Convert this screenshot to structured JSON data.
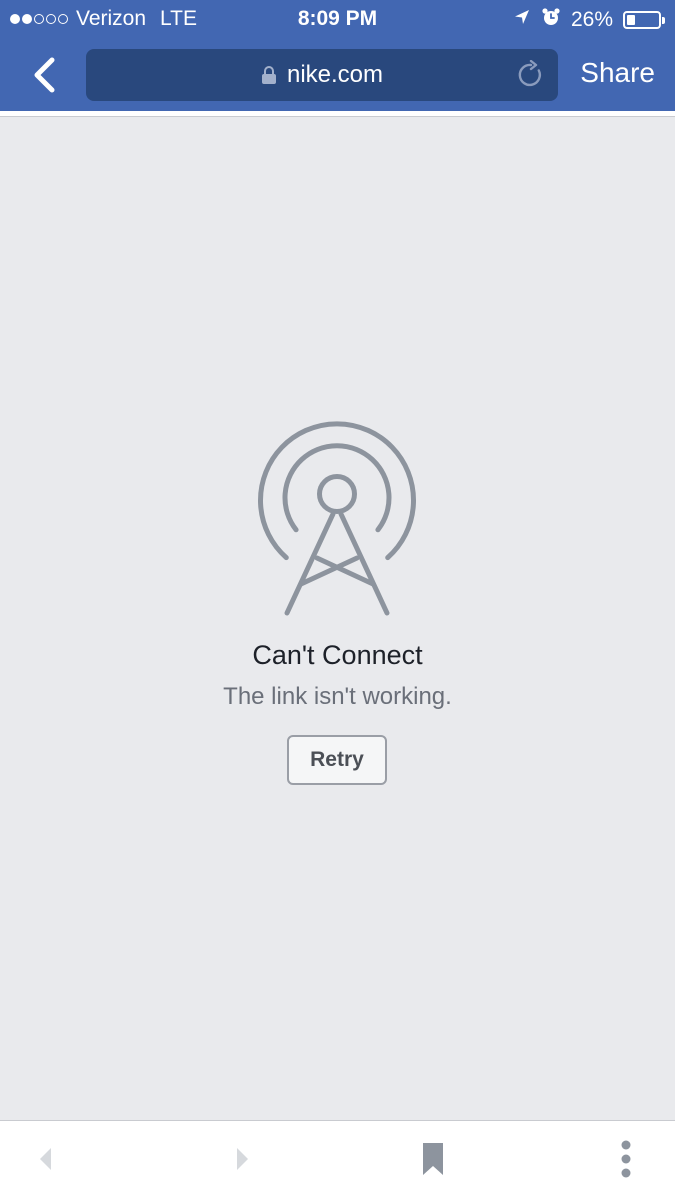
{
  "status_bar": {
    "signal_filled": 2,
    "signal_empty": 3,
    "carrier": "Verizon",
    "network": "LTE",
    "time": "8:09 PM",
    "battery_percent_text": "26%",
    "battery_level": 0.26,
    "icons": [
      "location-arrow-icon",
      "alarm-clock-icon",
      "battery-icon"
    ]
  },
  "nav_bar": {
    "back_icon": "chevron-left-icon",
    "url": "nike.com",
    "lock_icon": "lock-icon",
    "reload_icon": "reload-icon",
    "share_label": "Share"
  },
  "error": {
    "illustration_icon": "broadcast-tower-icon",
    "title": "Can't Connect",
    "message": "The link isn't working.",
    "retry_label": "Retry"
  },
  "toolbar": {
    "icons": [
      "back-arrow-icon",
      "forward-arrow-icon",
      "bookmark-icon",
      "more-options-icon"
    ]
  },
  "colors": {
    "brand_blue": "#4267b2",
    "url_field": "#29487d",
    "background": "#e9eaed",
    "icon_gray": "#8d949e"
  }
}
